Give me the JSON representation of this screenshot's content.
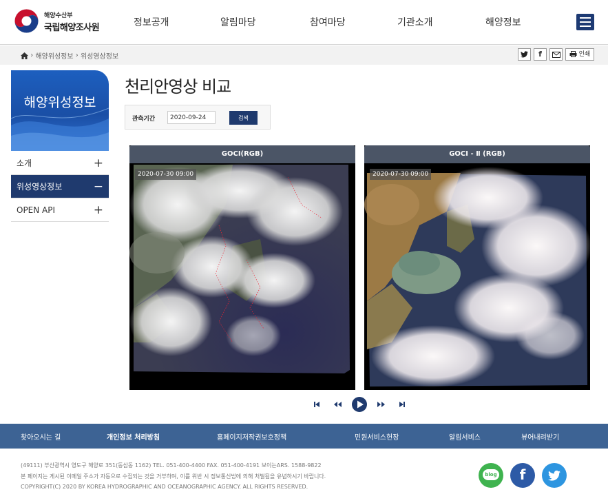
{
  "header": {
    "org_small": "해양수산부",
    "org_name": "국립해양조사원",
    "nav": [
      "정보공개",
      "알림마당",
      "참여마당",
      "기관소개",
      "해양정보"
    ]
  },
  "breadcrumb": {
    "items": [
      "해양위성정보",
      "위성영상정보"
    ],
    "print_label": "인쇄"
  },
  "sidebar": {
    "title": "해양위성정보",
    "items": [
      {
        "label": "소개",
        "sign": "+"
      },
      {
        "label": "위성영상정보",
        "sign": "−"
      },
      {
        "label": "OPEN API",
        "sign": "+"
      }
    ]
  },
  "main": {
    "title": "천리안영상 비교",
    "search": {
      "label": "관측기간",
      "date_value": "2020-09-24",
      "button_label": "검색"
    },
    "panels": [
      {
        "title": "GOCI(RGB)",
        "timestamp": "2020-07-30 09:00"
      },
      {
        "title": "GOCI - Ⅱ (RGB)",
        "timestamp": "2020-07-30 09:00"
      }
    ]
  },
  "footer": {
    "links": [
      "찾아오시는 길",
      "개인정보 처리방침",
      "홈페이지저작권보호정책",
      "민원서비스헌장",
      "알림서비스",
      "뷰어내려받기"
    ],
    "address": "(49111) 부산광역시 영도구 해양로 351(동삼동 1162)    TEL. 051-400-4400    FAX. 051-400-4191    보이는ARS. 1588-9822",
    "notice": "본 페이지는 게시된 이메일 주소가 자동으로 수집되는 것을 거부하며, 이를 위반 시 정보통신법에 의해 처벌됨을 유념하시기 바랍니다.",
    "copyright": "COPYRIGHT(C) 2020 BY KOREA HYDROGRAPHIC AND OCEANOGRAPHIC AGENCY. ALL RIGHTS RESERVED.",
    "blog_label": "blog",
    "facebook_label": "f"
  },
  "colors": {
    "brand_navy": "#1f3a6e",
    "footer_blue": "#3d6394",
    "panel_head": "#4b5566"
  }
}
